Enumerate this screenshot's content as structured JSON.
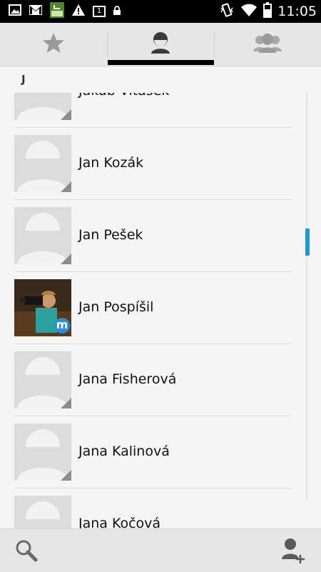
{
  "status_bar": {
    "time": "11:05",
    "notification_icons": [
      "gallery-icon",
      "gmail-icon",
      "app-download-icon",
      "warning-icon",
      "calendar-icon",
      "lock-icon"
    ],
    "calendar_day": "1",
    "system_icons": [
      "vibrate-icon",
      "wifi-icon",
      "battery-icon"
    ]
  },
  "tabs": [
    {
      "name": "favorites",
      "icon": "star-icon",
      "selected": false
    },
    {
      "name": "contacts",
      "icon": "person-icon",
      "selected": true
    },
    {
      "name": "groups",
      "icon": "group-icon",
      "selected": false
    }
  ],
  "section_letter": "J",
  "contacts": [
    {
      "name": "Jakub Vitásek",
      "photo": false
    },
    {
      "name": "Jan Kozák",
      "photo": false
    },
    {
      "name": "Jan Pešek",
      "photo": false
    },
    {
      "name": "Jan Pospíšil",
      "photo": true,
      "badge": "m"
    },
    {
      "name": "Jana Fisherová",
      "photo": false
    },
    {
      "name": "Jana Kalinová",
      "photo": false
    },
    {
      "name": "Jana Kočová",
      "photo": false
    }
  ],
  "colors": {
    "accent": "#1c9ad6",
    "tab_indicator": "#000000",
    "placeholder_bg": "#dcdcdc",
    "placeholder_fg": "#f2f2f2"
  },
  "bottom_bar": {
    "left_icon": "search-icon",
    "right_icon": "add-contact-icon"
  }
}
